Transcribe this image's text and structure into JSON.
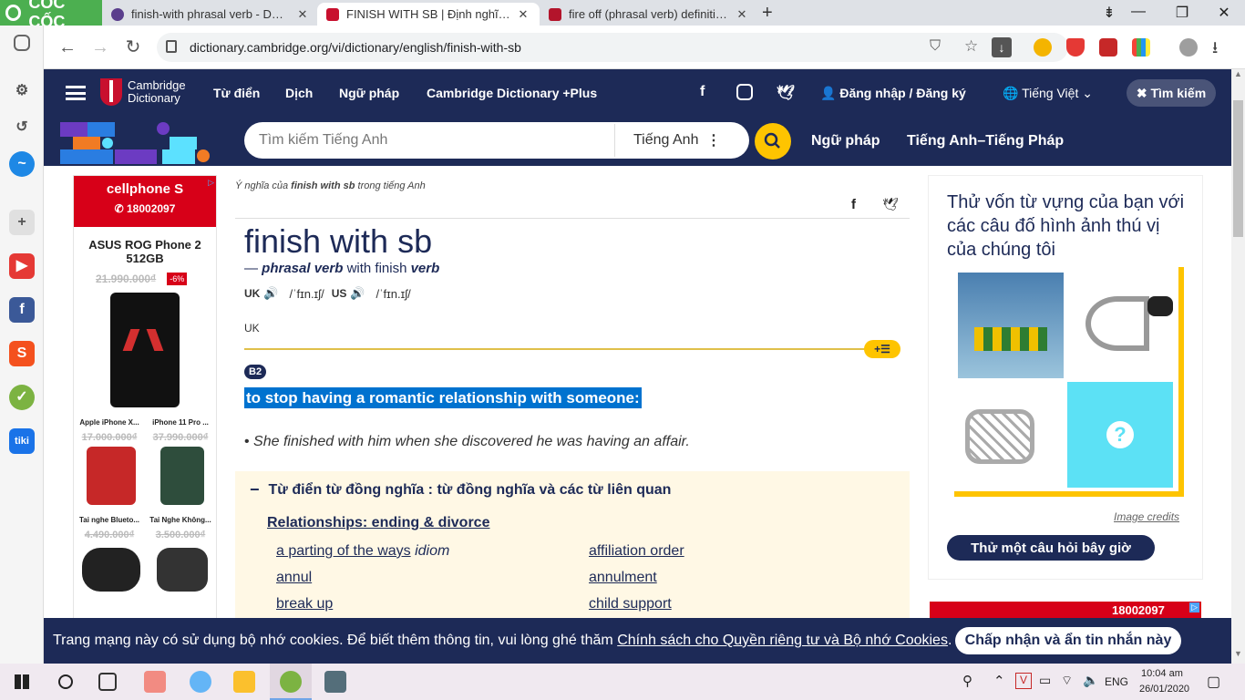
{
  "browser": {
    "name": "CỐC CỐC",
    "tabs": [
      {
        "title": "finish-with phrasal verb - Definitio",
        "active": false
      },
      {
        "title": "FINISH WITH SB | Định nghĩa trong",
        "active": true
      },
      {
        "title": "fire off (phrasal verb) definition and",
        "active": false
      }
    ],
    "url": "dictionary.cambridge.org/vi/dictionary/english/finish-with-sb"
  },
  "site": {
    "logo_line1": "Cambridge",
    "logo_line2": "Dictionary",
    "nav": [
      "Từ điển",
      "Dịch",
      "Ngữ pháp",
      "Cambridge Dictionary +Plus"
    ],
    "login": "Đăng nhập / Đăng ký",
    "language": "Tiếng Việt",
    "search_close": "Tìm kiếm",
    "search_placeholder": "Tìm kiếm Tiếng Anh",
    "search_lang": "Tiếng Anh",
    "band_links": [
      "Ngữ pháp",
      "Tiếng Anh–Tiếng Pháp"
    ]
  },
  "left_ad": {
    "brand": "cellphone S",
    "hotline": "18002097",
    "title": "ASUS ROG Phone 2 512GB",
    "old_price": "21.990.000₫",
    "discount": "-6%",
    "items": [
      {
        "name": "Apple iPhone X...",
        "price": "17.000.000₫"
      },
      {
        "name": "iPhone 11 Pro ...",
        "price": "37.990.000₫"
      },
      {
        "name": "Tai nghe Blueto...",
        "price": "4.490.000₫"
      },
      {
        "name": "Tai Nghe Không...",
        "price": "3.500.000₫"
      }
    ]
  },
  "entry": {
    "breadcrumb_prefix": "Ý nghĩa của",
    "breadcrumb_word": "finish with sb",
    "breadcrumb_suffix": "trong tiếng Anh",
    "headword": "finish with sb",
    "pos_dash": "—",
    "pos": "phrasal verb",
    "pos_with": "with finish",
    "pos_verb": "verb",
    "uk_label": "UK",
    "uk_ipa": "/ˈfɪn.ɪʃ/",
    "us_label": "US",
    "us_ipa": "/ˈfɪn.ɪʃ/",
    "region": "UK",
    "level": "B2",
    "definition": "to stop having a romantic relationship with someone:",
    "example": "She finished with him when she discovered he was having an affair.",
    "thesaurus_title": "Từ điển từ đồng nghĩa : từ đồng nghĩa và các từ liên quan",
    "thesaurus_topic": "Relationships: ending & divorce",
    "thesaurus_left": [
      "a parting of the ways",
      "annul",
      "break up"
    ],
    "thesaurus_left_tag": "idiom",
    "thesaurus_right": [
      "affiliation order",
      "annulment",
      "child support"
    ]
  },
  "quiz": {
    "text": "Thử vốn từ vựng của bạn với các câu đố hình ảnh thú vị của chúng tôi",
    "credits": "Image credits",
    "button": "Thử một câu hỏi bây giờ"
  },
  "right_ad": {
    "hotline": "18002097"
  },
  "cookie": {
    "text": "Trang mạng này có sử dụng bộ nhớ cookies. Để biết thêm thông tin, vui lòng ghé thăm",
    "link": "Chính sách cho Quyền riêng tư và Bộ nhớ Cookies",
    "end": ".",
    "accept": "Chấp nhận và ẩn tin nhắn này"
  },
  "taskbar": {
    "lang": "ENG",
    "time": "10:04 am",
    "date": "26/01/2020"
  },
  "colors": {
    "navy": "#1d2a57",
    "yellow": "#fec400",
    "highlight": "#0072cf",
    "cellphone_red": "#d70018"
  }
}
